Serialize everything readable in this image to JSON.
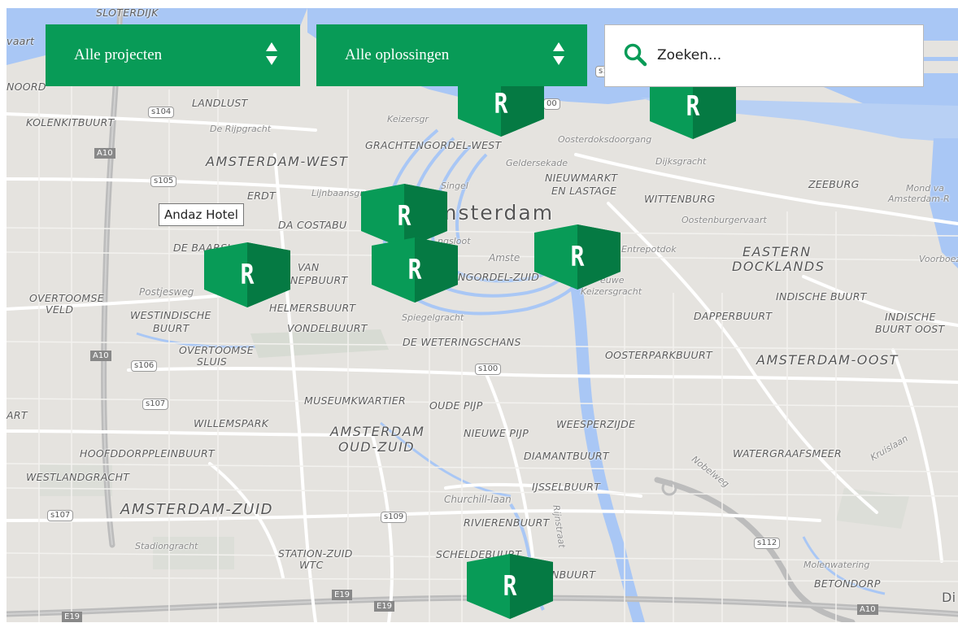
{
  "filters": [
    {
      "label": "Alle projecten"
    },
    {
      "label": "Alle oplossingen"
    }
  ],
  "search": {
    "placeholder": "Zoeken..."
  },
  "tooltip": {
    "text": "Andaz Hotel"
  },
  "marker_letter": "R",
  "colors": {
    "brand_green": "#089b57",
    "marker_dark": "#057a43",
    "water": "#a9c7f5"
  },
  "labels": {
    "city": "Amsterdam",
    "sloterdijk": "SLOTERDIJK",
    "vaart": "vaart",
    "noord": "NOORD",
    "landlust": "LANDLUST",
    "kolenkit": "KOLENKITBUURT",
    "rijpgracht": "De Rijpgracht",
    "keizersgr_top": "Keizersgr",
    "amsterdam_west": "AMSTERDAM-WEST",
    "grachtengordel_west": "GRACHTENGORDEL-WEST",
    "oosterdok": "Oosterdoksdoorgang",
    "geldersekade": "Geldersekade",
    "dijksgracht": "Dijksgracht",
    "singel": "Singel",
    "nieuwmarkt": "NIEUWMARKT",
    "en_lastage": "EN LASTAGE",
    "wittenburg": "WITTENBURG",
    "zeeburg": "ZEEBURG",
    "mond_van": "Mond va",
    "amsterdam_r": "Amsterdam-R",
    "lijnbaansgr": "Lijnbaansgra",
    "erdt": "ERDT",
    "oostenburg": "Oostenburgervaart",
    "da_costa": "DA COSTABU",
    "ngsloot": "ngsloot",
    "entrepotdok": "Entrepotdok",
    "eastern": "EASTERN",
    "docklands": "DOCKLANDS",
    "voorboez": "Voorboeze",
    "de_baarsj": "DE BAARSJ",
    "van": "VAN",
    "nepbuurt": "NEPBUURT",
    "amstel": "Amste",
    "grachtengordel_zuid": "NGORDEL-ZUID",
    "nieuwe_keizersgr": "Keizersgracht",
    "nieuwe": "euwe",
    "indische_buurt": "INDISCHE BUURT",
    "overtoomse_veld_1": "OVERTOOMSE",
    "overtoomse_veld_2": "VELD",
    "postjesweg": "Postjesweg",
    "westindische": "WESTINDISCHE",
    "buurt": "BUURT",
    "helmersbuurt": "HELMERSBUURT",
    "vondelbuurt": "VONDELBUURT",
    "spiegelgracht": "Spiegelgracht",
    "dapperbuurt": "DAPPERBUURT",
    "indische_oost_1": "INDISCHE",
    "indische_oost_2": "BUURT OOST",
    "de_weteringschans": "DE WETERINGSCHANS",
    "overtoomse_sluis_1": "OVERTOOMSE",
    "overtoomse_sluis_2": "SLUIS",
    "oosterparkbuurt": "OOSTERPARKBUURT",
    "amsterdam_oost": "AMSTERDAM-OOST",
    "museumkwartier": "MUSEUMKWARTIER",
    "oude_pijp": "OUDE PIJP",
    "art": "ART",
    "willemspark": "WILLEMSPARK",
    "amsterdam_oudzuid_1": "AMSTERDAM",
    "amsterdam_oudzuid_2": "OUD-ZUID",
    "nieuwe_pijp": "NIEUWE PIJP",
    "weesperzijde": "WEESPERZIJDE",
    "hoofddorpplein": "HOOFDDORPPLEINBUURT",
    "diamantbuurt": "DIAMANTBUURT",
    "nobelweg": "Nobelweg",
    "watergraafsmeer": "WATERGRAAFSMEER",
    "kruislaan": "Kruislaan",
    "westlandgracht": "WESTLANDGRACHT",
    "ijsselbuurt": "IJSSELBUURT",
    "churchill": "Churchill-laan",
    "amsterdam_zuid": "AMSTERDAM-ZUID",
    "rijnstraat": "Rijnstraat",
    "rivierenbuurt": "RIVIERENBUURT",
    "stadiongracht": "Stadiongracht",
    "station_zuid_1": "STATION-ZUID",
    "station_zuid_2": "WTC",
    "scheldebuurt": "SCHELDEBUURT",
    "nbuurt": "NBUURT",
    "molenwatering": "Molenwatering",
    "betondorp": "BETONDORP",
    "di": "Di"
  },
  "shields": {
    "s104": "s104",
    "s105": "s105",
    "s106": "s106",
    "s107a": "s107",
    "s107b": "s107",
    "s109": "s109",
    "s100": "s100",
    "s112": "s112",
    "s1": "s1",
    "s00": "00"
  },
  "highways": {
    "a10_nw": "A10",
    "a10_w": "A10",
    "a10_se": "A10",
    "e19_a": "E19",
    "e19_b": "E19",
    "e19_c": "E19"
  }
}
